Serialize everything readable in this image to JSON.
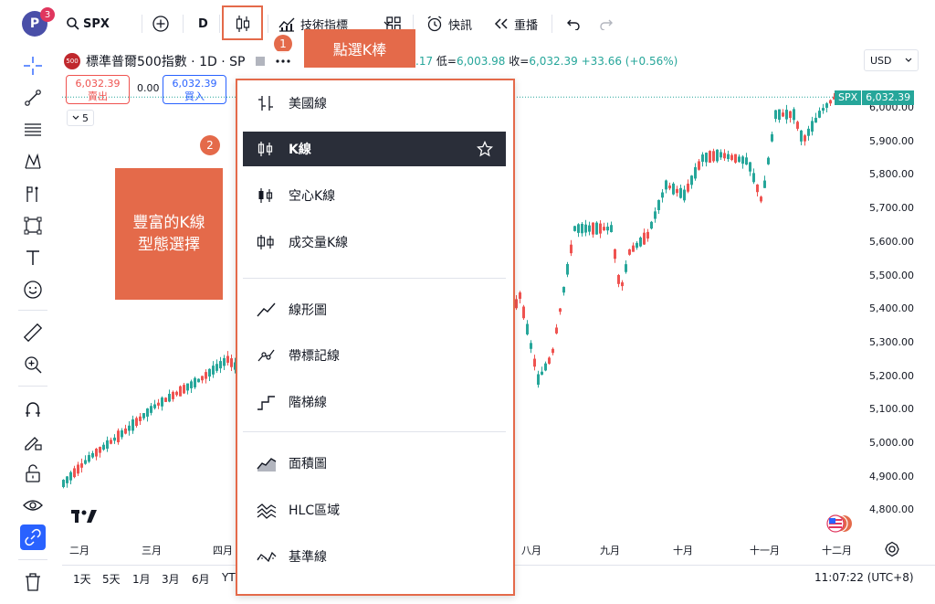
{
  "topbar": {
    "avatar_letter": "P",
    "avatar_badge": "3",
    "symbol": "SPX",
    "interval": "D",
    "indicators_label": "技術指標",
    "alerts_label": "快訊",
    "replay_label": "重播"
  },
  "annotations": {
    "step1": "1",
    "step1_text": "點選K棒",
    "step2": "2",
    "step2_text_line1": "豐富的K線",
    "step2_text_line2": "型態選擇"
  },
  "legend": {
    "logo_text": "500",
    "title": "標準普爾500指數 · 1D · SP",
    "ohlc_partial": ".17",
    "low_label": "低=",
    "low_value": "6,003.98",
    "close_label": "收=",
    "close_value": "6,032.39",
    "change": "+33.66 (+0.56%)"
  },
  "trade": {
    "sell_price": "6,032.39",
    "sell_label": "賣出",
    "spread": "0.00",
    "buy_price": "6,032.39",
    "buy_label": "買入",
    "collapse_count": "5"
  },
  "price_axis": {
    "currency": "USD",
    "symbol_tag": "SPX",
    "last_price": "6,032.39",
    "ticks": [
      "6,000.00",
      "5,900.00",
      "5,800.00",
      "5,700.00",
      "5,600.00",
      "5,500.00",
      "5,400.00",
      "5,300.00",
      "5,200.00",
      "5,100.00",
      "5,000.00",
      "4,900.00",
      "4,800.00"
    ]
  },
  "time_axis": {
    "months": [
      "二月",
      "三月",
      "四月",
      "八月",
      "九月",
      "十月",
      "十一月",
      "十二月"
    ]
  },
  "bottombar": {
    "ranges": [
      "1天",
      "5天",
      "1月",
      "3月",
      "6月",
      "YTD"
    ],
    "clock": "11:07:22 (UTC+8)"
  },
  "chart_type_menu": {
    "groups": [
      [
        {
          "label": "美國線",
          "icon": "bars-icon",
          "active": false
        },
        {
          "label": "K線",
          "icon": "candles-icon",
          "active": true
        },
        {
          "label": "空心K線",
          "icon": "hollow-candles-icon",
          "active": false
        },
        {
          "label": "成交量K線",
          "icon": "volume-candles-icon",
          "active": false
        }
      ],
      [
        {
          "label": "線形圖",
          "icon": "line-icon",
          "active": false
        },
        {
          "label": "帶標記線",
          "icon": "line-markers-icon",
          "active": false
        },
        {
          "label": "階梯線",
          "icon": "step-line-icon",
          "active": false
        }
      ],
      [
        {
          "label": "面積圖",
          "icon": "area-icon",
          "active": false
        },
        {
          "label": "HLC區域",
          "icon": "hlc-area-icon",
          "active": false
        },
        {
          "label": "基準線",
          "icon": "baseline-icon",
          "active": false
        }
      ]
    ]
  },
  "colors": {
    "up": "#26a69a",
    "down": "#ef5350",
    "annotation": "#e46a4a",
    "menu_active_bg": "#2a2e39"
  }
}
